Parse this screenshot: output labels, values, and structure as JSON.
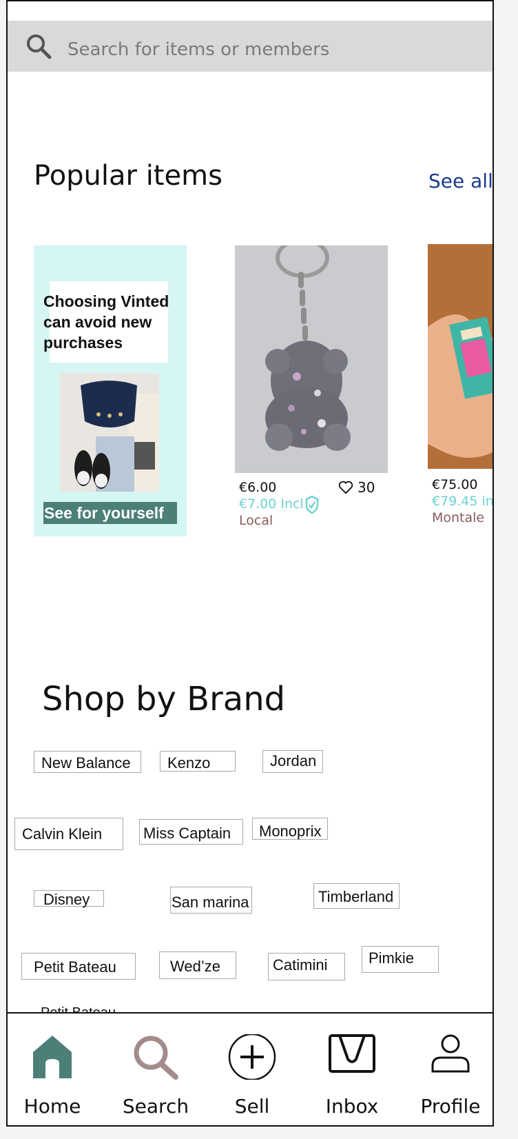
{
  "search": {
    "placeholder": "Search for items or members"
  },
  "popular": {
    "title": "Popular items",
    "see_all": "See all",
    "promo": {
      "text": "Choosing Vinted can avoid new purchases",
      "cta": "See for yourself"
    },
    "items": [
      {
        "price": "€6.00",
        "price_incl": "€7.00 Incl",
        "location": "Local",
        "likes": "30"
      },
      {
        "price": "€75.00",
        "price_incl": "€79.45 in",
        "location": "Montale"
      }
    ]
  },
  "brands": {
    "title": "Shop by Brand",
    "chips": [
      "New Balance",
      "Kenzo",
      "Jordan",
      "Calvin Klein",
      "Miss Captain",
      "Monoprix",
      "Disney",
      "San marina",
      "Timberland",
      "Petit Bateau",
      "Wed’ze",
      "Catimini",
      "Pimkie"
    ]
  },
  "tabbar": {
    "items": [
      {
        "label": "Home",
        "icon": "home-icon",
        "active": true
      },
      {
        "label": "Search",
        "icon": "search-icon"
      },
      {
        "label": "Sell",
        "icon": "plus-circle-icon"
      },
      {
        "label": "Inbox",
        "icon": "inbox-icon"
      },
      {
        "label": "Profile",
        "icon": "profile-icon"
      }
    ]
  },
  "colors": {
    "accent": "#4d7f79",
    "promo_bg": "#d6f6f4",
    "link": "#1b3a8a",
    "price_incl": "#6fd2d0",
    "location": "#8a5a5a"
  }
}
